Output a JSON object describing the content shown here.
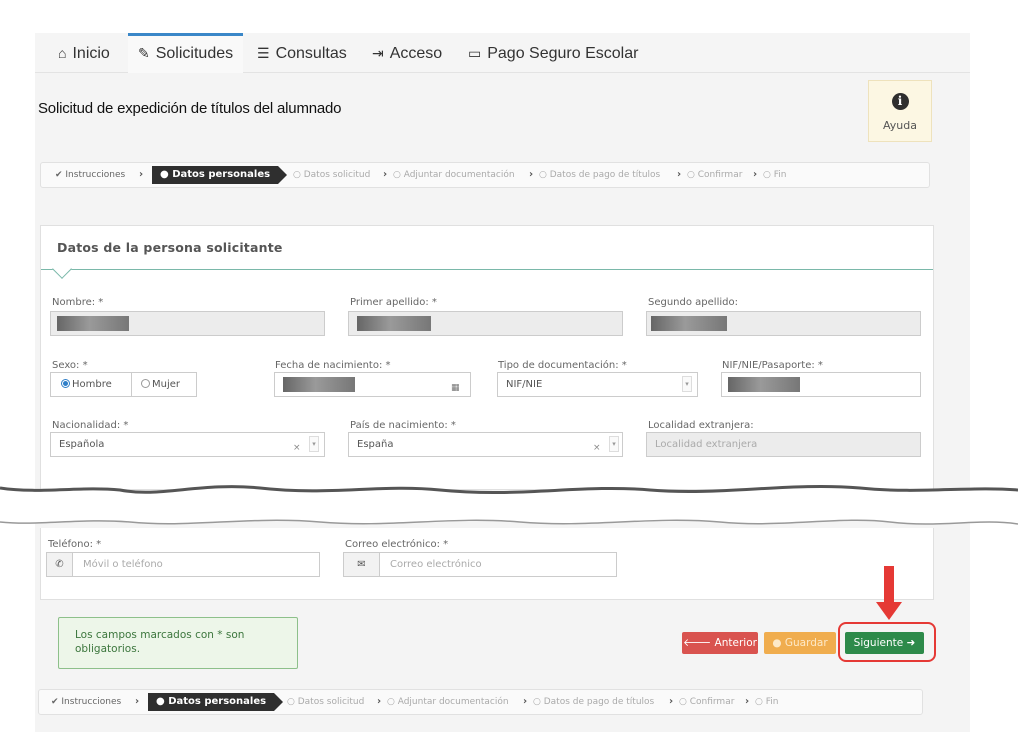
{
  "nav": [
    {
      "icon": "home-icon",
      "glyph": "⌂",
      "label": "Inicio"
    },
    {
      "icon": "pencil-icon",
      "glyph": "✎",
      "label": "Solicitudes"
    },
    {
      "icon": "list-icon",
      "glyph": "☰",
      "label": "Consultas"
    },
    {
      "icon": "login-icon",
      "glyph": "⇥",
      "label": "Acceso"
    },
    {
      "icon": "credit-card-icon",
      "glyph": "▭",
      "label": "Pago Seguro Escolar"
    }
  ],
  "page_title": "Solicitud de expedición de títulos del alumnado",
  "help_label": "Ayuda",
  "steps": {
    "s1": "Instrucciones",
    "s2": "Datos personales",
    "s3": "Datos solicitud",
    "s4": "Adjuntar documentación",
    "s5": "Datos de pago de títulos",
    "s6": "Confirmar",
    "s7": "Fin"
  },
  "panel_title": "Datos de la persona solicitante",
  "form": {
    "nombre_label": "Nombre: *",
    "primer_apellido_label": "Primer apellido: *",
    "segundo_apellido_label": "Segundo apellido:",
    "sexo_label": "Sexo: *",
    "sexo_hombre": "Hombre",
    "sexo_mujer": "Mujer",
    "fecha_label": "Fecha de nacimiento: *",
    "tipo_doc_label": "Tipo de documentación: *",
    "tipo_doc_value": "NIF/NIE",
    "nif_label": "NIF/NIE/Pasaporte: *",
    "nacionalidad_label": "Nacionalidad: *",
    "nacionalidad_value": "Española",
    "pais_label": "País de nacimiento: *",
    "pais_value": "España",
    "localidad_label": "Localidad extranjera:",
    "localidad_placeholder": "Localidad extranjera",
    "telefono_label": "Teléfono: *",
    "telefono_placeholder": "Móvil o teléfono",
    "correo_label": "Correo electrónico: *",
    "correo_placeholder": "Correo electrónico"
  },
  "note_text": "Los campos marcados con * son obligatorios.",
  "buttons": {
    "prev": "Anterior",
    "save": "Guardar",
    "next": "Siguiente"
  }
}
